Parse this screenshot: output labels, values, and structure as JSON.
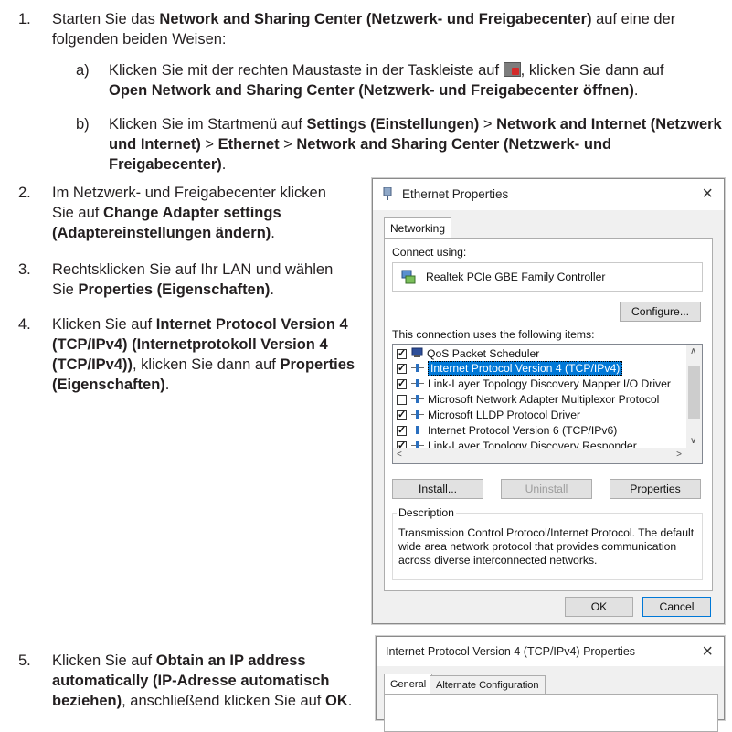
{
  "steps": {
    "s1": {
      "num": "1.",
      "parts": [
        "Starten Sie das ",
        "Network and Sharing Center (Netzwerk- und Freigabecenter)",
        " auf eine der folgenden beiden Weisen:"
      ]
    },
    "s1a": {
      "letter": "a)",
      "parts": [
        "Klicken Sie mit der rechten Maustaste in der Taskleiste auf ",
        ", klicken Sie dann auf ",
        "Open Network and Sharing Center (Netzwerk- und Freigabecenter öffnen)",
        "."
      ],
      "icon": "network-tray-icon"
    },
    "s1b": {
      "letter": "b)",
      "parts": [
        "Klicken Sie im Startmenü auf ",
        "Settings (Einstellungen)",
        " > ",
        "Network and Internet (Netzwerk und Internet)",
        " > ",
        "Ethernet",
        " > ",
        "Network and Sharing Center (Netzwerk- und Freigabecenter)",
        "."
      ]
    },
    "s2": {
      "num": "2.",
      "parts": [
        "Im Netzwerk- und Freigabecenter klicken Sie auf ",
        "Change Adapter settings (Adaptereinstellungen ändern)",
        "."
      ]
    },
    "s3": {
      "num": "3.",
      "parts": [
        "Rechtsklicken Sie auf Ihr LAN und wählen Sie ",
        "Properties (Eigenschaften)",
        "."
      ]
    },
    "s4": {
      "num": "4.",
      "parts": [
        "Klicken Sie auf ",
        "Internet Protocol Version 4 (TCP/IPv4) (Internetprotokoll Version 4 (TCP/IPv4))",
        ", klicken Sie dann auf ",
        "Properties (Eigenschaften)",
        "."
      ]
    },
    "s5": {
      "num": "5.",
      "parts": [
        "Klicken Sie auf ",
        "Obtain an IP address automatically (IP-Adresse automatisch beziehen)",
        ", anschließend klicken Sie auf ",
        "OK",
        "."
      ]
    }
  },
  "ethernet_dialog": {
    "title": "Ethernet Properties",
    "close": "×",
    "tab": "Networking",
    "connect_using_label": "Connect using:",
    "adapter_name": "Realtek PCIe GBE Family Controller",
    "configure_button": "Configure...",
    "items_label": "This connection uses the following items:",
    "items": [
      {
        "label": "QoS Packet Scheduler",
        "checked": true,
        "icon": "scheduler-icon"
      },
      {
        "label": "Internet Protocol Version 4 (TCP/IPv4)",
        "checked": true,
        "icon": "protocol-icon",
        "selected": true
      },
      {
        "label": "Link-Layer Topology Discovery Mapper I/O Driver",
        "checked": true,
        "icon": "protocol-icon"
      },
      {
        "label": "Microsoft Network Adapter Multiplexor Protocol",
        "checked": false,
        "icon": "protocol-icon"
      },
      {
        "label": "Microsoft LLDP Protocol Driver",
        "checked": true,
        "icon": "protocol-icon"
      },
      {
        "label": "Internet Protocol Version 6 (TCP/IPv6)",
        "checked": true,
        "icon": "protocol-icon"
      },
      {
        "label": "Link-Layer Topology Discovery Responder",
        "checked": true,
        "icon": "protocol-icon"
      }
    ],
    "install_button": "Install...",
    "uninstall_button": "Uninstall",
    "properties_button": "Properties",
    "description_title": "Description",
    "description_lines": [
      "Transmission Control Protocol/Internet Protocol. The default",
      "wide area network protocol that provides communication",
      "across diverse interconnected networks."
    ],
    "ok_button": "OK",
    "cancel_button": "Cancel"
  },
  "ipv4_dialog": {
    "title": "Internet Protocol Version 4 (TCP/IPv4) Properties",
    "close": "×",
    "tabs": [
      "General",
      "Alternate Configuration"
    ]
  }
}
